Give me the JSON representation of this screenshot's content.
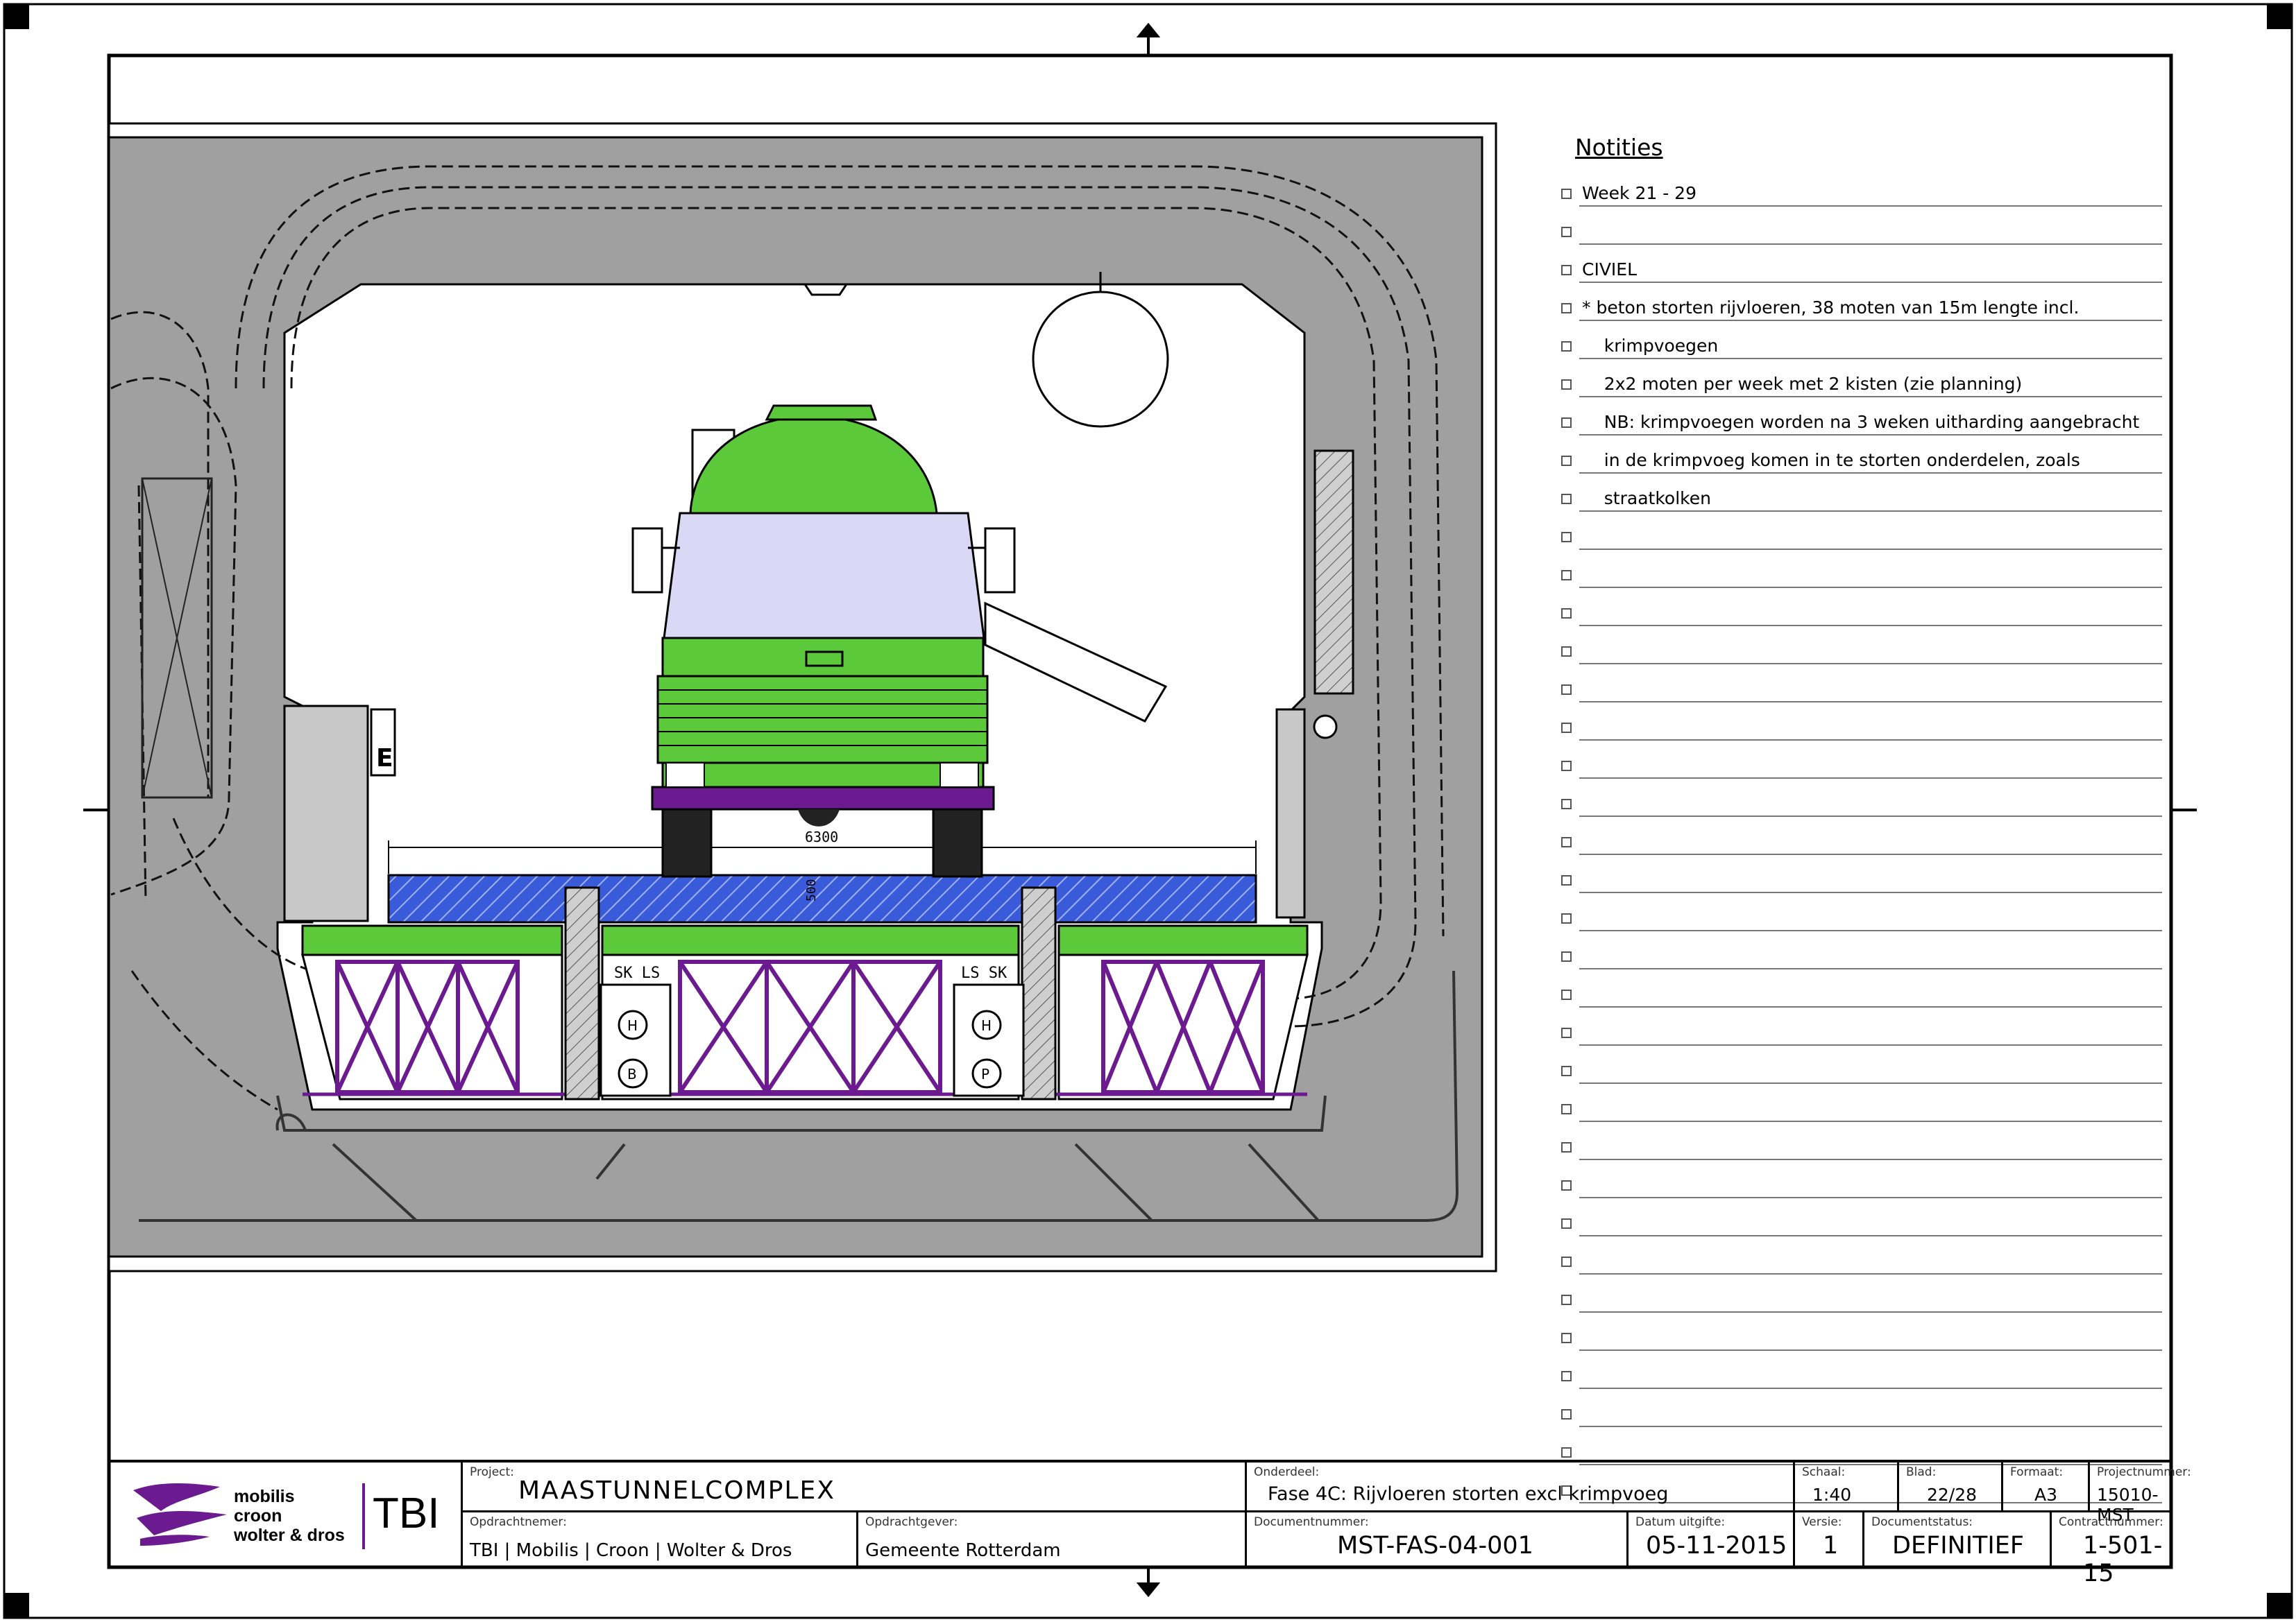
{
  "notes": {
    "title": "Notities",
    "items": [
      "Week 21 - 29",
      "",
      "CIVIEL",
      "* beton storten rijvloeren, 38 moten van 15m lengte incl.",
      "    krimpvoegen",
      "    2x2 moten per week met 2 kisten (zie planning)",
      "    NB: krimpvoegen worden na 3 weken uitharding aangebracht",
      "    in de krimpvoeg komen in te storten onderdelen, zoals",
      "    straatkolken",
      "",
      "",
      "",
      "",
      "",
      "",
      "",
      "",
      "",
      "",
      "",
      "",
      "",
      "",
      "",
      "",
      "",
      "",
      "",
      "",
      "",
      "",
      "",
      "",
      "",
      ""
    ]
  },
  "drawing": {
    "dimension": "6300",
    "thickness": "500",
    "cell_labels_left": "SK  LS",
    "cell_labels_right": "LS  SK",
    "symbol_h": "H",
    "symbol_b": "B",
    "symbol_p": "P",
    "sign_e": "E"
  },
  "title_block": {
    "logo": {
      "line1": "mobilis",
      "line2": "croon",
      "line3": "wolter & dros",
      "tbi": "TBI"
    },
    "project_label": "Project:",
    "project": "MAASTUNNELCOMPLEX",
    "contractor_label": "Opdrachtnemer:",
    "contractor": "TBI | Mobilis | Croon | Wolter & Dros",
    "client_label": "Opdrachtgever:",
    "client": "Gemeente Rotterdam",
    "part_label": "Onderdeel:",
    "part": "Fase 4C: Rijvloeren storten excl krimpvoeg",
    "docnum_label": "Documentnummer:",
    "docnum": "MST-FAS-04-001",
    "date_label": "Datum uitgifte:",
    "date": "05-11-2015",
    "scale_label": "Schaal:",
    "scale": "1:40",
    "sheet_label": "Blad:",
    "sheet": "22/28",
    "format_label": "Formaat:",
    "format": "A3",
    "projnum_label": "Projectnummer:",
    "projnum": "15010-MST",
    "version_label": "Versie:",
    "version": "1",
    "status_label": "Documentstatus:",
    "status": "DEFINITIEF",
    "contract_label": "Contractnummer:",
    "contract": "1-501-15"
  },
  "colors": {
    "concrete_grey": "#a0a0a0",
    "fill_blue": "#3a5bd9",
    "green": "#5cc93a",
    "purple": "#6b1b8f",
    "cab_lavender": "#d9d9f5"
  }
}
